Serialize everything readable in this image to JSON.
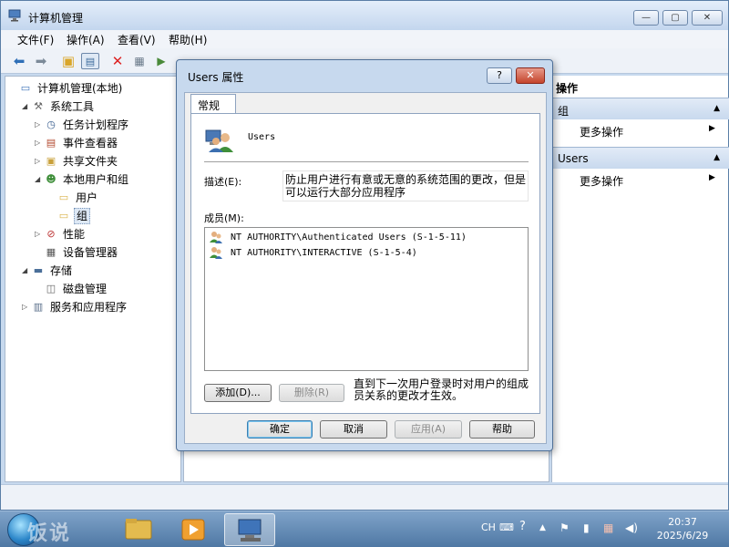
{
  "window": {
    "title": "计算机管理"
  },
  "menu": [
    "文件(F)",
    "操作(A)",
    "查看(V)",
    "帮助(H)"
  ],
  "tree": [
    {
      "label": "计算机管理(本地)",
      "icon": "computer-management-icon",
      "level": 0,
      "expander": ""
    },
    {
      "label": "系统工具",
      "icon": "system-tools-icon",
      "level": 1,
      "expander": "▲"
    },
    {
      "label": "任务计划程序",
      "icon": "clock-icon",
      "level": 2,
      "expander": "▷"
    },
    {
      "label": "事件查看器",
      "icon": "event-viewer-icon",
      "level": 2,
      "expander": "▷"
    },
    {
      "label": "共享文件夹",
      "icon": "shared-folder-icon",
      "level": 2,
      "expander": "▷"
    },
    {
      "label": "本地用户和组",
      "icon": "users-icon",
      "level": 2,
      "expander": "▲"
    },
    {
      "label": "用户",
      "icon": "folder-icon",
      "level": 3,
      "expander": ""
    },
    {
      "label": "组",
      "icon": "folder-icon",
      "level": 3,
      "expander": "",
      "selected": true
    },
    {
      "label": "性能",
      "icon": "performance-icon",
      "level": 2,
      "expander": "▷"
    },
    {
      "label": "设备管理器",
      "icon": "device-manager-icon",
      "level": 2,
      "expander": ""
    },
    {
      "label": "存储",
      "icon": "storage-icon",
      "level": 1,
      "expander": "▲"
    },
    {
      "label": "磁盘管理",
      "icon": "disk-icon",
      "level": 2,
      "expander": ""
    },
    {
      "label": "服务和应用程序",
      "icon": "services-icon",
      "level": 1,
      "expander": "▷"
    }
  ],
  "actions": {
    "header": "操作",
    "sections": [
      {
        "title": "组",
        "item": "更多操作"
      },
      {
        "title": "Users",
        "item": "更多操作"
      }
    ]
  },
  "dialog": {
    "title": "Users 属性",
    "help_label": "?",
    "close_label": "✕",
    "tab": "常规",
    "group_name": "Users",
    "desc_label": "描述(E):",
    "description": "防止用户进行有意或无意的系统范围的更改，但是可以运行大部分应用程序",
    "members_label": "成员(M):",
    "members": [
      "NT AUTHORITY\\Authenticated Users (S-1-5-11)",
      "NT AUTHORITY\\INTERACTIVE (S-1-5-4)"
    ],
    "add_button": "添加(D)...",
    "remove_button": "删除(R)",
    "note": "直到下一次用户登录时对用户的组成员关系的更改才生效。",
    "ok_button": "确定",
    "cancel_button": "取消",
    "apply_button": "应用(A)",
    "help_button": "帮助"
  },
  "taskbar": {
    "watermark": "饭说",
    "lang": "CH",
    "time": "20:37",
    "date": "2025/6/29"
  },
  "colors": {
    "accent": "#3c7fb1",
    "window_frame": "#c7d9ee"
  }
}
